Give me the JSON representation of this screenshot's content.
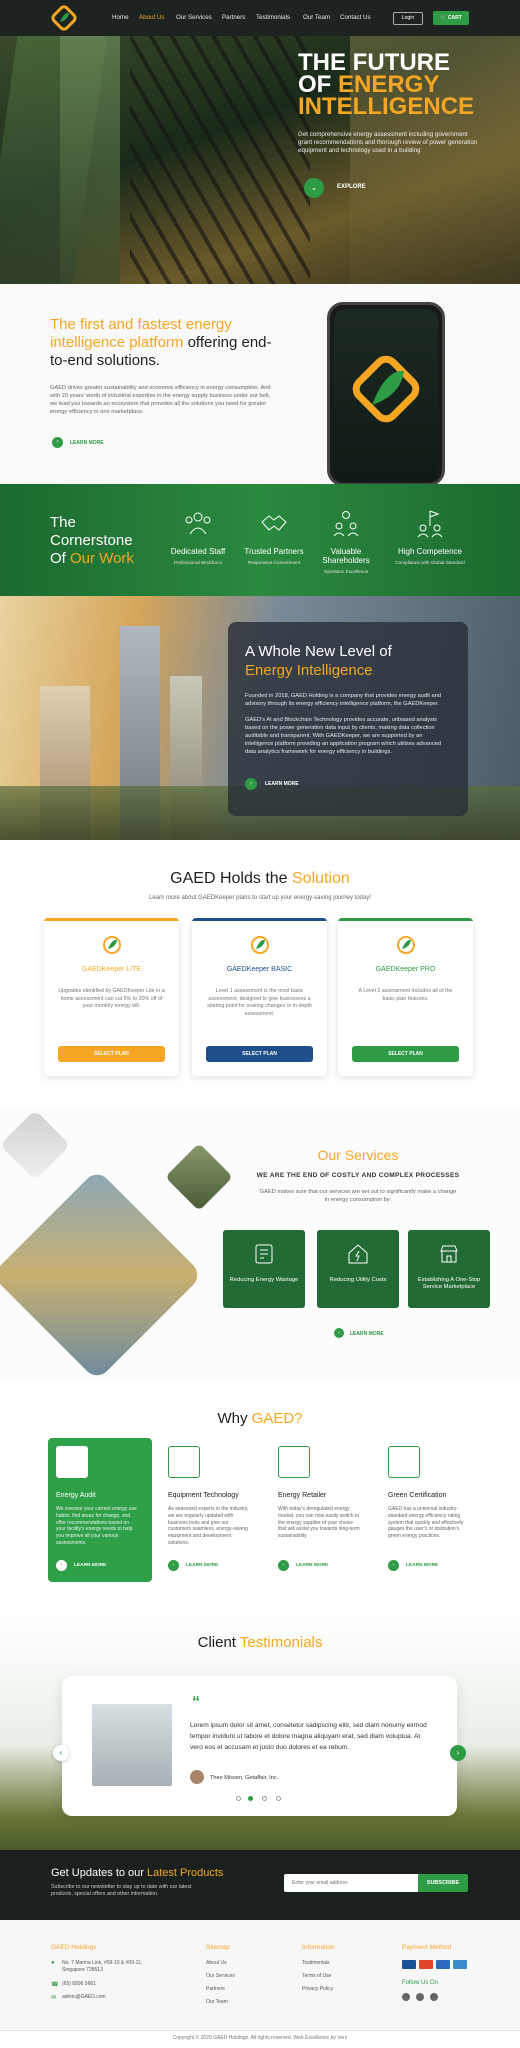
{
  "nav": {
    "links": [
      "Home",
      "About Us",
      "Our Services",
      "Partners",
      "Testimonials",
      "Our Team",
      "Contact Us"
    ],
    "login": "Login",
    "cart": "CART"
  },
  "hero": {
    "title_line1": "THE FUTURE",
    "title_of": "OF ",
    "title_energy": "ENERGY",
    "title_line3": "INTELLIGENCE",
    "description": "Get comprehensive energy assessment including government grant recommendations and thorough review of power generation equipment and technology used in a building",
    "explore": "EXPLORE"
  },
  "about": {
    "title_orange": "The first and fastest energy intelligence platform",
    "title_dark": " offering end-to-end solutions.",
    "description": "GAED drives greater sustainability and economic efficiency in energy consumption. And with 20 years' worth of industrial expertise in the energy supply business under our belt, we lead you towards an ecosystem that provides all the solutions you need for greater energy efficiency in one marketplace.",
    "learn_more": "LEARN MORE"
  },
  "cornerstone": {
    "title_line1": "The",
    "title_line2": "Cornerstone",
    "title_of": "Of ",
    "title_work": "Our Work",
    "items": [
      {
        "label": "Dedicated Staff",
        "sub": "Professional Workforce"
      },
      {
        "label": "Trusted Partners",
        "sub": "Responsive Commitment"
      },
      {
        "label": "Valuable Shareholders",
        "sub": "Operation Excellence"
      },
      {
        "label": "High Competence",
        "sub": "Compliance with Global Standard"
      }
    ]
  },
  "energy": {
    "title_line1": "A Whole New Level of",
    "title_line2": "Energy Intelligence",
    "p1": "Founded in 2018, GAED Holding is a company that provides energy audit and advisory through its energy efficiency intelligence platform, the GAEDKeeper.",
    "p2": "GAED's AI and Blockchain Technology provides accurate, unbiased analysis based on the power generation data input by clients, making data collection auditable and transparent. With GAEDKeeper, we are supported by an intelligence platform providing an application program which utilises advanced data analytics framework for energy efficiency in buildings.",
    "learn_more": "LEARN MORE"
  },
  "plans": {
    "title_dark": "GAED Holds the ",
    "title_orange": "Solution",
    "subtitle": "Learn more about GAEDKeeper plans to start up your energy-saving journey today!",
    "cards": [
      {
        "name": "GAEDKeeper LITE",
        "desc": "Upgrades identified by GAEDKeeper Lite in a home assessment can cut 5% to 30% off of your monthly energy bill.",
        "button": "SELECT PLAN",
        "color": "#f5a623"
      },
      {
        "name": "GAEDKeeper BASIC",
        "desc": "Level 1 assessment is the most basic assessment, designed to give businesses a starting point for making changes or in-depth assessment.",
        "button": "SELECT PLAN",
        "color": "#1e4f8a"
      },
      {
        "name": "GAEDKeeper PRO",
        "desc": "A Level 2 assessment includes all of the basic plan features.",
        "button": "SELECT PLAN",
        "color": "#2e9b45"
      }
    ]
  },
  "services": {
    "title": "Our Services",
    "subtitle": "WE ARE THE END OF COSTLY AND COMPLEX PROCESSES",
    "description": "GAED makes sure that our services are set out to significantly make a change in energy consumption by:",
    "cards": [
      {
        "label": "Reducing Energy Wastage"
      },
      {
        "label": "Reducing Utility Costs"
      },
      {
        "label": "Establishing A One-Stop Service Marketplace"
      }
    ],
    "learn_more": "LEARN MORE"
  },
  "why": {
    "title_dark": "Why ",
    "title_orange": "GAED?",
    "items": [
      {
        "title": "Energy Audit",
        "desc": "We oversee your current energy use habits, find areas for change, and offer recommendations based on your facility's energy needs to help you improve all your various assessments.",
        "learn": "LEARN MORE"
      },
      {
        "title": "Equipment Technology",
        "desc": "As seasoned experts in the industry, we are regularly updated with business tools and give our customers seamless, energy-saving equipment and development solutions.",
        "learn": "LEARN MORE"
      },
      {
        "title": "Energy Retailer",
        "desc": "With today's deregulated energy market, you can now easily switch to the energy supplier of your choice that will assist you towards long-term sustainability.",
        "learn": "LEARN MORE"
      },
      {
        "title": "Green Certification",
        "desc": "GAED has a universal industry-standard energy efficiency rating system that quickly and effectively gauges the user's or institution's green energy practices.",
        "learn": "LEARN MORE"
      }
    ]
  },
  "testimonials": {
    "title_dark": "Client ",
    "title_orange": "Testimonials",
    "quote_mark": "“",
    "text": "Lorem ipsum dolor sit amet, consetetur sadipscing elitr, sed diam nonumy eirmod tempor invidunt ut labore et dolore magna aliquyam erat, sed diam voluptua. At vero eos et accusam et justo duo dolores et ea rebum.",
    "author": "Theo Missen, Getaffair, Inc."
  },
  "newsletter": {
    "title_white": "Get Updates to our ",
    "title_orange": "Latest Products",
    "desc": "Subscribe to our newsletter to stay up to date with our latest products, special offers and other information.",
    "placeholder": "Enter your email address",
    "button": "SUBSCRIBE"
  },
  "footer": {
    "col1_head": "GAED Holdings",
    "address": "No. 7 Marina Link, #09-10 & #09-11, Singapore 728513",
    "phone": "(65) 6896 5661",
    "email": "admin@GAED.com",
    "col2_head": "Sitemap",
    "col2_links": [
      "About Us",
      "Our Services",
      "Partners",
      "Our Team"
    ],
    "col3_head": "Information",
    "col3_links": [
      "Testimonials",
      "Terms of Use",
      "Privacy Policy"
    ],
    "col4_head": "Payment Method",
    "follow": "Follow Us On",
    "copyright": "Copyright © 2020 GAED Holdings. All rights reserved. Web Excellence by Verz"
  },
  "colors": {
    "green": "#2e9b45",
    "orange": "#f5a623",
    "dark": "#1c2321"
  }
}
